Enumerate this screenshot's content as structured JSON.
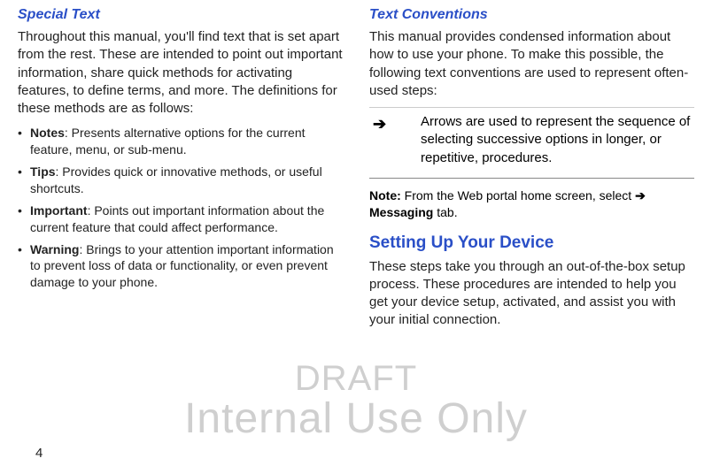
{
  "left": {
    "heading": "Special Text",
    "intro": "Throughout this manual, you'll find text that is set apart from the rest. These are intended to point out important information, share quick methods for activating features, to define terms, and more. The definitions for these methods are as follows:",
    "bullets": [
      {
        "term": "Notes",
        "desc": ": Presents alternative options for the current feature, menu, or sub-menu."
      },
      {
        "term": "Tips",
        "desc": ": Provides quick or innovative methods, or useful shortcuts."
      },
      {
        "term": "Important",
        "desc": ": Points out important information about the current feature that could affect performance."
      },
      {
        "term": "Warning",
        "desc": ": Brings to your attention important information to prevent loss of data or functionality, or even prevent damage to your phone."
      }
    ]
  },
  "right": {
    "heading": "Text Conventions",
    "intro": "This manual provides condensed information about how to use your phone. To make this possible, the following text conventions are used to represent often-used steps:",
    "conv": {
      "symbol": "➔",
      "desc": "Arrows are used to represent the sequence of selecting successive options in longer, or repetitive, procedures."
    },
    "note": {
      "label": "Note:",
      "pre": " From the Web portal home screen, select ",
      "arrow": "➔",
      "msg": " Messaging",
      "post": " tab."
    },
    "h2": "Setting Up Your Device",
    "body2": "These steps take you through an out-of-the-box setup process. These procedures are intended to help you get your device setup, activated, and assist you with your initial connection."
  },
  "watermark": {
    "l1": "DRAFT",
    "l2": "Internal Use Only"
  },
  "pagenum": "4"
}
